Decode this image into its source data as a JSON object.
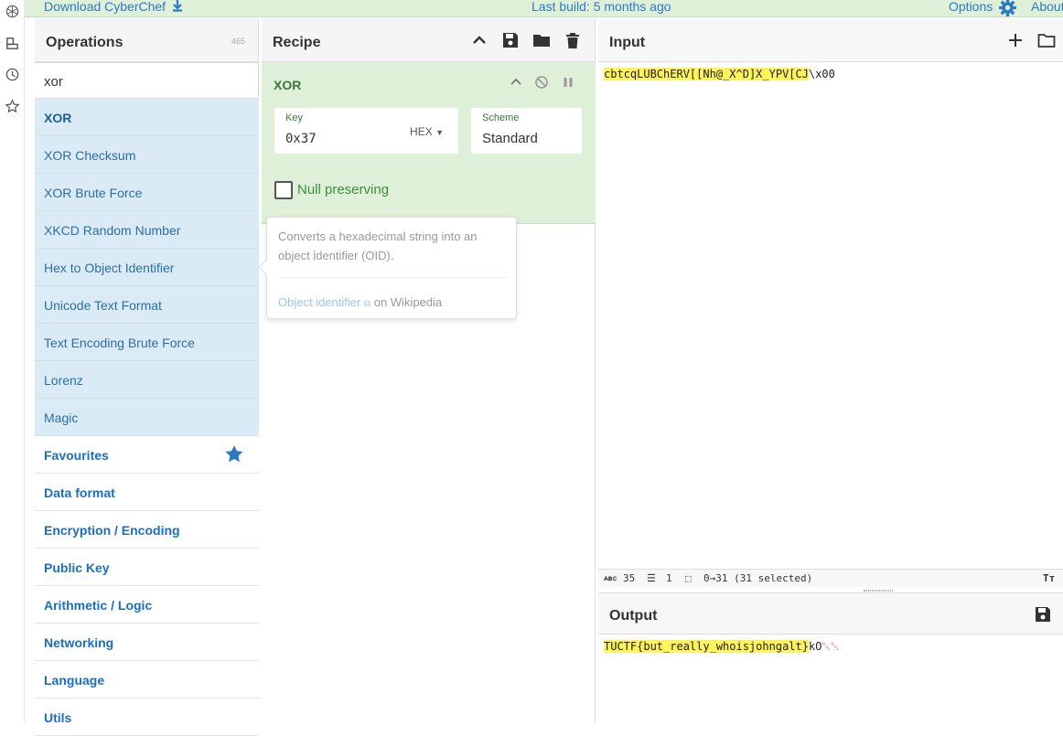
{
  "banner": {
    "download": "Download CyberChef",
    "build": "Last build: 5 months ago",
    "options": "Options",
    "about": "About"
  },
  "operations": {
    "title": "Operations",
    "count": "465",
    "search_value": "xor",
    "results": [
      "XOR",
      "XOR Checksum",
      "XOR Brute Force",
      "XKCD Random Number",
      "Hex to Object Identifier",
      "Unicode Text Format",
      "Text Encoding Brute Force",
      "Lorenz",
      "Magic"
    ],
    "categories": [
      "Favourites",
      "Data format",
      "Encryption / Encoding",
      "Public Key",
      "Arithmetic / Logic",
      "Networking",
      "Language",
      "Utils"
    ]
  },
  "recipe": {
    "title": "Recipe",
    "op_name": "XOR",
    "key_label": "Key",
    "key_value": "0x37",
    "key_format": "HEX",
    "scheme_label": "Scheme",
    "scheme_value": "Standard",
    "null_preserving": "Null preserving"
  },
  "tooltip": {
    "description": "Converts a hexadecimal string into an object identifier (OID).",
    "link": "Object identifier",
    "link_suffix": "on Wikipedia"
  },
  "input": {
    "title": "Input",
    "text_highlighted": "cbtcqLUBChERV[[Nh@_X^D]X_YPV[CJ",
    "text_rest": "\\x00",
    "stats": {
      "length": "35",
      "lines": "1",
      "selection": "0→31 (31 selected)"
    },
    "font_button": "Tт"
  },
  "output": {
    "title": "Output",
    "text_highlighted": "TUCTF{but_really_whoisjohngalt}",
    "text_plain": "kO",
    "text_control": "␀␀"
  },
  "colors": {
    "accent_blue": "#2d79c7",
    "banner_green": "#dff0d8",
    "highlight_yellow": "#fff35c",
    "op_result_bg": "#daebf5"
  }
}
